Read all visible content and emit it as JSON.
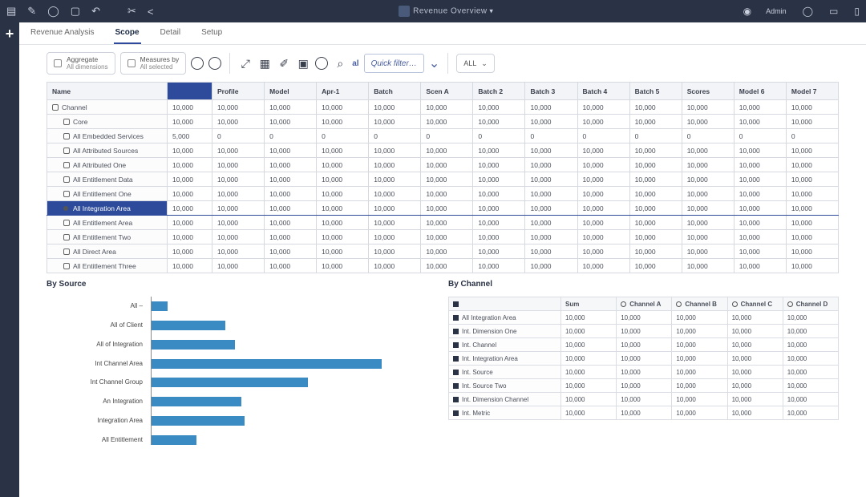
{
  "titlebar": {
    "brand": "Revenue Overview",
    "user": "Admin"
  },
  "tabs": [
    "Revenue Analysis",
    "Scope",
    "Detail",
    "Setup"
  ],
  "active_tab": 1,
  "toolbar": {
    "seg1_top": "Aggregate",
    "seg1_bot": "All dimensions",
    "seg2_top": "Measures by",
    "seg2_bot": "All selected",
    "search_label": "al",
    "search_text": "Quick filter…",
    "pill": "ALL"
  },
  "grid": {
    "col_headers": [
      "Name",
      "",
      "Profile",
      "Model",
      "Apr-1",
      "Batch",
      "Scen A",
      "Batch 2",
      "Batch 3",
      "Batch 4",
      "Batch 5",
      "Scores",
      "Model 6",
      "Model 7"
    ],
    "selected_col": 1,
    "rows": [
      {
        "indent": 0,
        "label": "Channel",
        "cells": [
          "10,000",
          "10,000",
          "10,000",
          "10,000",
          "10,000",
          "10,000",
          "10,000",
          "10,000",
          "10,000",
          "10,000",
          "10,000",
          "10,000",
          "10,000"
        ]
      },
      {
        "indent": 1,
        "label": "Core",
        "cells": [
          "10,000",
          "10,000",
          "10,000",
          "10,000",
          "10,000",
          "10,000",
          "10,000",
          "10,000",
          "10,000",
          "10,000",
          "10,000",
          "10,000",
          "10,000"
        ]
      },
      {
        "indent": 1,
        "label": "All Embedded Services",
        "cells": [
          "5,000",
          "0",
          "0",
          "0",
          "0",
          "0",
          "0",
          "0",
          "0",
          "0",
          "0",
          "0",
          "0"
        ]
      },
      {
        "indent": 1,
        "label": "All Attributed Sources",
        "cells": [
          "10,000",
          "10,000",
          "10,000",
          "10,000",
          "10,000",
          "10,000",
          "10,000",
          "10,000",
          "10,000",
          "10,000",
          "10,000",
          "10,000",
          "10,000"
        ]
      },
      {
        "indent": 1,
        "label": "All Attributed One",
        "cells": [
          "10,000",
          "10,000",
          "10,000",
          "10,000",
          "10,000",
          "10,000",
          "10,000",
          "10,000",
          "10,000",
          "10,000",
          "10,000",
          "10,000",
          "10,000"
        ]
      },
      {
        "indent": 1,
        "label": "All Entitlement Data",
        "cells": [
          "10,000",
          "10,000",
          "10,000",
          "10,000",
          "10,000",
          "10,000",
          "10,000",
          "10,000",
          "10,000",
          "10,000",
          "10,000",
          "10,000",
          "10,000"
        ]
      },
      {
        "indent": 1,
        "label": "All Entitlement One",
        "cells": [
          "10,000",
          "10,000",
          "10,000",
          "10,000",
          "10,000",
          "10,000",
          "10,000",
          "10,000",
          "10,000",
          "10,000",
          "10,000",
          "10,000",
          "10,000"
        ]
      },
      {
        "indent": 2,
        "label": "All Integration Area",
        "cells": [
          "10,000",
          "10,000",
          "10,000",
          "10,000",
          "10,000",
          "10,000",
          "10,000",
          "10,000",
          "10,000",
          "10,000",
          "10,000",
          "10,000",
          "10,000"
        ],
        "selected": true
      },
      {
        "indent": 1,
        "label": "All Entitlement Area",
        "cells": [
          "10,000",
          "10,000",
          "10,000",
          "10,000",
          "10,000",
          "10,000",
          "10,000",
          "10,000",
          "10,000",
          "10,000",
          "10,000",
          "10,000",
          "10,000"
        ]
      },
      {
        "indent": 1,
        "label": "All Entitlement Two",
        "cells": [
          "10,000",
          "10,000",
          "10,000",
          "10,000",
          "10,000",
          "10,000",
          "10,000",
          "10,000",
          "10,000",
          "10,000",
          "10,000",
          "10,000",
          "10,000"
        ]
      },
      {
        "indent": 1,
        "label": "All Direct Area",
        "cells": [
          "10,000",
          "10,000",
          "10,000",
          "10,000",
          "10,000",
          "10,000",
          "10,000",
          "10,000",
          "10,000",
          "10,000",
          "10,000",
          "10,000",
          "10,000"
        ]
      },
      {
        "indent": 1,
        "label": "All Entitlement Three",
        "cells": [
          "10,000",
          "10,000",
          "10,000",
          "10,000",
          "10,000",
          "10,000",
          "10,000",
          "10,000",
          "10,000",
          "10,000",
          "10,000",
          "10,000",
          "10,000"
        ]
      }
    ]
  },
  "chart_left_title": "By Source",
  "chart_right_title": "By Channel",
  "chart_data": {
    "type": "bar",
    "orientation": "horizontal",
    "title": "By Source",
    "xlabel": "",
    "ylabel": "",
    "categories": [
      "All –",
      "All of Client",
      "All of Integration",
      "Int Channel Area",
      "Int Channel Group",
      "An Integration",
      "Integration Area",
      "All Entitlement"
    ],
    "values": [
      18,
      78,
      88,
      242,
      165,
      95,
      98,
      48
    ],
    "xlim": [
      0,
      300
    ],
    "color": "#3a8ac4"
  },
  "subtable": {
    "headers": [
      "",
      "Sum",
      "Channel A",
      "Channel B",
      "Channel C",
      "Channel D"
    ],
    "rows": [
      {
        "label": "All Integration Area",
        "cells": [
          "10,000",
          "10,000",
          "10,000",
          "10,000",
          "10,000"
        ]
      },
      {
        "label": "Int. Dimension One",
        "cells": [
          "10,000",
          "10,000",
          "10,000",
          "10,000",
          "10,000"
        ]
      },
      {
        "label": "Int. Channel",
        "cells": [
          "10,000",
          "10,000",
          "10,000",
          "10,000",
          "10,000"
        ]
      },
      {
        "label": "Int. Integration Area",
        "cells": [
          "10,000",
          "10,000",
          "10,000",
          "10,000",
          "10,000"
        ]
      },
      {
        "label": "Int. Source",
        "cells": [
          "10,000",
          "10,000",
          "10,000",
          "10,000",
          "10,000"
        ]
      },
      {
        "label": "Int. Source Two",
        "cells": [
          "10,000",
          "10,000",
          "10,000",
          "10,000",
          "10,000"
        ]
      },
      {
        "label": "Int. Dimension Channel",
        "cells": [
          "10,000",
          "10,000",
          "10,000",
          "10,000",
          "10,000"
        ]
      },
      {
        "label": "Int. Metric",
        "cells": [
          "10,000",
          "10,000",
          "10,000",
          "10,000",
          "10,000"
        ]
      }
    ]
  }
}
